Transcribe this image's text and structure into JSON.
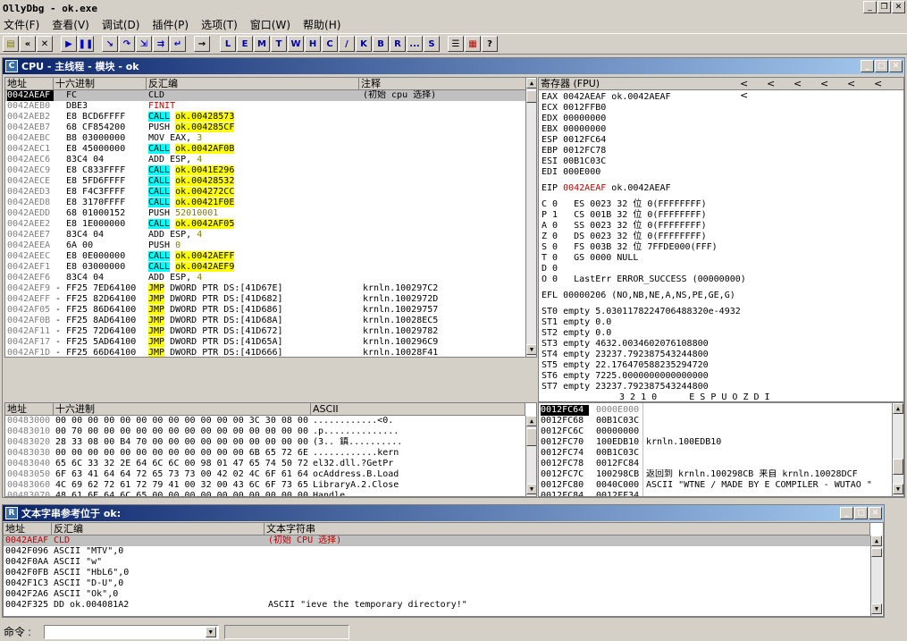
{
  "app": {
    "title": "OllyDbg - ok.exe"
  },
  "menu": [
    "文件(F)",
    "查看(V)",
    "调试(D)",
    "插件(P)",
    "选项(T)",
    "窗口(W)",
    "帮助(H)"
  ],
  "toolbar": {
    "letters": [
      "L",
      "E",
      "M",
      "T",
      "W",
      "H",
      "C",
      "/",
      "K",
      "B",
      "R",
      "...",
      "S"
    ]
  },
  "cpu": {
    "title": "CPU - 主线程 - 模块 - ok",
    "headers": {
      "addr": "地址",
      "hex": "十六进制",
      "disasm": "反汇编",
      "comment": "注释"
    },
    "rows": [
      {
        "addr": "0042AEAF",
        "hex": "FC",
        "op": "CLD",
        "arg": "",
        "comment": "(初始 cpu 选择)",
        "mark": "",
        "sel": true
      },
      {
        "addr": "0042AEB0",
        "hex": "DBE3",
        "op": "FINIT",
        "arg": "",
        "comment": "",
        "mark": "",
        "kind": "red"
      },
      {
        "addr": "0042AEB2",
        "hex": "E8 BCD6FFFF",
        "op": "CALL",
        "arg": "ok.00428573",
        "comment": "",
        "mark": "",
        "kind": "call"
      },
      {
        "addr": "0042AEB7",
        "hex": "68 CF854200",
        "op": "PUSH",
        "arg": "ok.004285CF",
        "comment": "",
        "mark": "",
        "kind": "push"
      },
      {
        "addr": "0042AEBC",
        "hex": "B8 03000000",
        "op": "MOV EAX,",
        "arg": "3",
        "comment": "",
        "mark": "",
        "kind": "num"
      },
      {
        "addr": "0042AEC1",
        "hex": "E8 45000000",
        "op": "CALL",
        "arg": "ok.0042AF0B",
        "comment": "",
        "mark": "",
        "kind": "call"
      },
      {
        "addr": "0042AEC6",
        "hex": "83C4 04",
        "op": "ADD ESP,",
        "arg": "4",
        "comment": "",
        "mark": "",
        "kind": "num"
      },
      {
        "addr": "0042AEC9",
        "hex": "E8 C833FFFF",
        "op": "CALL",
        "arg": "ok.0041E296",
        "comment": "",
        "mark": "",
        "kind": "call"
      },
      {
        "addr": "0042AECE",
        "hex": "E8 5FD6FFFF",
        "op": "CALL",
        "arg": "ok.00428532",
        "comment": "",
        "mark": "",
        "kind": "call"
      },
      {
        "addr": "0042AED3",
        "hex": "E8 F4C3FFFF",
        "op": "CALL",
        "arg": "ok.004272CC",
        "comment": "",
        "mark": "",
        "kind": "call"
      },
      {
        "addr": "0042AED8",
        "hex": "E8 3170FFFF",
        "op": "CALL",
        "arg": "ok.00421F0E",
        "comment": "",
        "mark": "",
        "kind": "call"
      },
      {
        "addr": "0042AEDD",
        "hex": "68 01000152",
        "op": "PUSH",
        "arg": "52010001",
        "comment": "",
        "mark": "",
        "kind": "pushnum"
      },
      {
        "addr": "0042AEE2",
        "hex": "E8 1E000000",
        "op": "CALL",
        "arg": "ok.0042AF05",
        "comment": "",
        "mark": "",
        "kind": "call"
      },
      {
        "addr": "0042AEE7",
        "hex": "83C4 04",
        "op": "ADD ESP,",
        "arg": "4",
        "comment": "",
        "mark": "",
        "kind": "num"
      },
      {
        "addr": "0042AEEA",
        "hex": "6A 00",
        "op": "PUSH",
        "arg": "0",
        "comment": "",
        "mark": "",
        "kind": "pushnum"
      },
      {
        "addr": "0042AEEC",
        "hex": "E8 0E000000",
        "op": "CALL",
        "arg": "ok.0042AEFF",
        "comment": "",
        "mark": "",
        "kind": "call"
      },
      {
        "addr": "0042AEF1",
        "hex": "E8 03000000",
        "op": "CALL",
        "arg": "ok.0042AEF9",
        "comment": "",
        "mark": "",
        "kind": "call"
      },
      {
        "addr": "0042AEF6",
        "hex": "83C4 04",
        "op": "ADD ESP,",
        "arg": "4",
        "comment": "",
        "mark": "",
        "kind": "num"
      },
      {
        "addr": "0042AEF9",
        "hex": "FF25 7ED64100",
        "op": "JMP",
        "arg": "DWORD PTR DS:[41D67E]",
        "comment": "krnln.100297C2",
        "mark": "-",
        "kind": "jmp"
      },
      {
        "addr": "0042AEFF",
        "hex": "FF25 82D64100",
        "op": "JMP",
        "arg": "DWORD PTR DS:[41D682]",
        "comment": "krnln.1002972D",
        "mark": "-",
        "kind": "jmp"
      },
      {
        "addr": "0042AF05",
        "hex": "FF25 86D64100",
        "op": "JMP",
        "arg": "DWORD PTR DS:[41D686]",
        "comment": "krnln.10029757",
        "mark": "-",
        "kind": "jmp"
      },
      {
        "addr": "0042AF0B",
        "hex": "FF25 8AD64100",
        "op": "JMP",
        "arg": "DWORD PTR DS:[41D68A]",
        "comment": "krnln.10028EC5",
        "mark": "-",
        "kind": "jmp"
      },
      {
        "addr": "0042AF11",
        "hex": "FF25 72D64100",
        "op": "JMP",
        "arg": "DWORD PTR DS:[41D672]",
        "comment": "krnln.10029782",
        "mark": "-",
        "kind": "jmp"
      },
      {
        "addr": "0042AF17",
        "hex": "FF25 5AD64100",
        "op": "JMP",
        "arg": "DWORD PTR DS:[41D65A]",
        "comment": "krnln.100296C9",
        "mark": "-",
        "kind": "jmp"
      },
      {
        "addr": "0042AF1D",
        "hex": "FF25 66D64100",
        "op": "JMP",
        "arg": "DWORD PTR DS:[41D666]",
        "comment": "krnln.10028F41",
        "mark": "-",
        "kind": "jmp"
      }
    ]
  },
  "registers": {
    "title": "寄存器 (FPU)",
    "arrows": [
      "<",
      "<",
      "<",
      "<",
      "<",
      "<",
      "<"
    ],
    "gpr": [
      {
        "name": "EAX",
        "val": "0042AEAF",
        "info": "ok.0042AEAF"
      },
      {
        "name": "ECX",
        "val": "0012FFB0",
        "info": ""
      },
      {
        "name": "EDX",
        "val": "00000000",
        "info": ""
      },
      {
        "name": "EBX",
        "val": "00000000",
        "info": ""
      },
      {
        "name": "ESP",
        "val": "0012FC64",
        "info": ""
      },
      {
        "name": "EBP",
        "val": "0012FC78",
        "info": ""
      },
      {
        "name": "ESI",
        "val": "00B1C03C",
        "info": ""
      },
      {
        "name": "EDI",
        "val": "000E000",
        "info": ""
      }
    ],
    "eip": {
      "name": "EIP",
      "val": "0042AEAF",
      "info": "ok.0042AEAF"
    },
    "flags": [
      "C 0   ES 0023 32 位 0(FFFFFFFF)",
      "P 1   CS 001B 32 位 0(FFFFFFFF)",
      "A 0   SS 0023 32 位 0(FFFFFFFF)",
      "Z 0   DS 0023 32 位 0(FFFFFFFF)",
      "S 0   FS 003B 32 位 7FFDE000(FFF)",
      "T 0   GS 0000 NULL",
      "D 0",
      "O 0   LastErr ERROR_SUCCESS (00000000)"
    ],
    "efl": "EFL 00000206 (NO,NB,NE,A,NS,PE,GE,G)",
    "fpu": [
      "ST0 empty 5.0301178224706488320e-4932",
      "ST1 empty 0.0",
      "ST2 empty 0.0",
      "ST3 empty 4632.0034602076108800",
      "ST4 empty 23237.792387543244800",
      "ST5 empty 22.176470588235294720",
      "ST6 empty 7225.0000000000000000",
      "ST7 empty 23237.792387543244800"
    ],
    "fpu_footer": "3 2 1 0      E S P U O Z D I"
  },
  "dump": {
    "headers": {
      "addr": "地址",
      "hex": "十六进制",
      "ascii": "ASCII"
    },
    "rows": [
      {
        "addr": "00483000",
        "hex": "00 00 00 00 00 00 00 00 00 00 00 00 3C 30 08 00",
        "ascii": "............<0."
      },
      {
        "addr": "00483010",
        "hex": "00 70 00 00 00 00 00 00 00 00 00 00 00 00 00 00",
        "ascii": ".p.............."
      },
      {
        "addr": "00483020",
        "hex": "28 33 08 00 B4 70 00 00 00 00 00 00 00 00 00 00",
        "ascii": "(3.. 鎮.........."
      },
      {
        "addr": "00483030",
        "hex": "00 00 00 00 00 00 00 00 00 00 00 00 6B 65 72 6E",
        "ascii": "............kern"
      },
      {
        "addr": "00483040",
        "hex": "65 6C 33 32 2E 64 6C 6C 00 98 01 47 65 74 50 72",
        "ascii": "el32.dll.?GetPr"
      },
      {
        "addr": "00483050",
        "hex": "6F 63 41 64 64 72 65 73 73 00 42 02 4C 6F 61 64",
        "ascii": "ocAddress.B.Load"
      },
      {
        "addr": "00483060",
        "hex": "4C 69 62 72 61 72 79 41 00 32 00 43 6C 6F 73 65",
        "ascii": "LibraryA.2.Close"
      },
      {
        "addr": "00483070",
        "hex": "48 61 6E 64 6C 65 00 00 00 00 00 00 00 00 00 00",
        "ascii": "Handle.........."
      }
    ]
  },
  "stack": {
    "rows": [
      {
        "addr": "0012FC64",
        "val": "0000E000",
        "comment": "",
        "sel": true
      },
      {
        "addr": "0012FC68",
        "val": "00B1C03C",
        "comment": ""
      },
      {
        "addr": "0012FC6C",
        "val": "00000000",
        "comment": ""
      },
      {
        "addr": "0012FC70",
        "val": "100EDB10",
        "comment": "krnln.100EDB10"
      },
      {
        "addr": "0012FC74",
        "val": "00B1C03C",
        "comment": ""
      },
      {
        "addr": "0012FC78",
        "val": "0012FC84",
        "comment": ""
      },
      {
        "addr": "0012FC7C",
        "val": "100298CB",
        "comment": "返回到 krnln.100298CB 来自 krnln.10028DCF"
      },
      {
        "addr": "0012FC80",
        "val": "0040C000",
        "comment": "ASCII \"WTNE / MADE BY E COMPILER - WUTAO \""
      },
      {
        "addr": "0012FC84",
        "val": "0012FF34",
        "comment": ""
      }
    ]
  },
  "strings": {
    "title": "文本字串参考位于 ok:",
    "headers": {
      "addr": "地址",
      "disasm": "反汇编",
      "text": "文本字符串"
    },
    "rows": [
      {
        "addr": "0042AEAF",
        "disasm": "CLD",
        "text": "(初始 CPU 选择)",
        "red": true
      },
      {
        "addr": "0042F096",
        "disasm": "ASCII \"MTV\",0",
        "text": ""
      },
      {
        "addr": "0042F0AA",
        "disasm": "ASCII \"w\"",
        "text": ""
      },
      {
        "addr": "0042F0FB",
        "disasm": "ASCII \"HbL6\",0",
        "text": ""
      },
      {
        "addr": "0042F1C3",
        "disasm": "ASCII \"D-U\",0",
        "text": ""
      },
      {
        "addr": "0042F2A6",
        "disasm": "ASCII \"Ok\",0",
        "text": ""
      },
      {
        "addr": "0042F325",
        "disasm": "DD ok.004081A2",
        "text": "ASCII \"ieve the temporary directory!\""
      }
    ]
  },
  "command": {
    "label": "命令 :"
  }
}
